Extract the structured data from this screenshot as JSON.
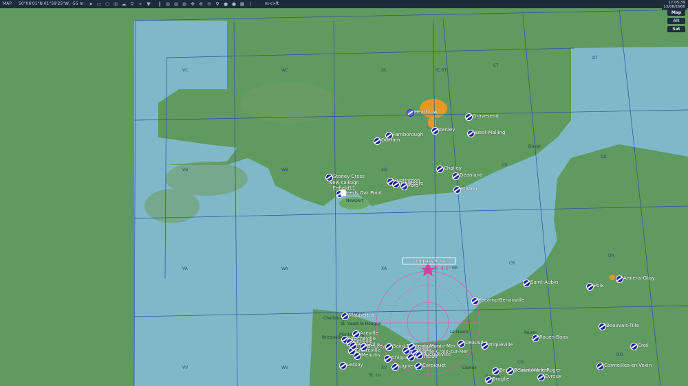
{
  "topbar": {
    "mode": "MAP",
    "coords": "50°06'01\"N 01°59'25\"W, -55 m",
    "units": "m<>ft"
  },
  "clock": {
    "time": "17:05:39",
    "date": "13/08/1980"
  },
  "map_buttons": [
    "Map",
    "Alt",
    "Sat"
  ],
  "compass": {
    "title": "Compass Rose",
    "bearing": "M -4.6°"
  },
  "grid_labels": [
    "VC",
    "WC",
    "XC",
    "YC BT",
    "CT",
    "DT",
    "VB",
    "WB",
    "XB",
    "CS",
    "DS",
    "VA",
    "WA",
    "XA",
    "BR",
    "CR",
    "DR",
    "VV",
    "WV",
    "XV",
    "CQ",
    "DQ"
  ],
  "towns": [
    "Dover",
    "Newport",
    "Cherbourg",
    "St. Vaast la Hougue",
    "Le Havre",
    "Rouen",
    "Bricquebec",
    "Montebourg",
    "Lisieux",
    "St. Lo",
    "Bernay",
    "Barfleur"
  ],
  "unit": {
    "callsign": "New callsign",
    "name": "Enfield11"
  },
  "airfields": [
    "Heathrow",
    "Gravesend",
    "Kenley",
    "West Malling",
    "Farnborough",
    "Odiham",
    "Chailey",
    "Deanland",
    "Stoney Cross",
    "Funtington",
    "Tangmere",
    "Ford",
    "Friston",
    "Needs Oar Point",
    "Saint-Aubin",
    "Poix",
    "Amiens-Glisy",
    "Fecamp-Benouville",
    "Maupertus",
    "Azeville",
    "Beauvais-Tille",
    "Rouen-Boos",
    "Deauville",
    "Triqueville",
    "Creil",
    "Cretteville",
    "Meautis",
    "Lessay",
    "Lignerolles",
    "Carpiquet",
    "Cormeilles-en-Vexin",
    "Bernay Saint Martin",
    "Beaumont-le-Roger",
    "Evreux",
    "Broglie",
    "Brucheville",
    "Biniville",
    "Picauville",
    "Beuzeville",
    "Saint Pierre du Mont",
    "Chippelle",
    "Le Molay",
    "Longues-sur-Mer",
    "Sainte-Croix-sur-Mer",
    "Lantheuil",
    "Rucqueville"
  ]
}
